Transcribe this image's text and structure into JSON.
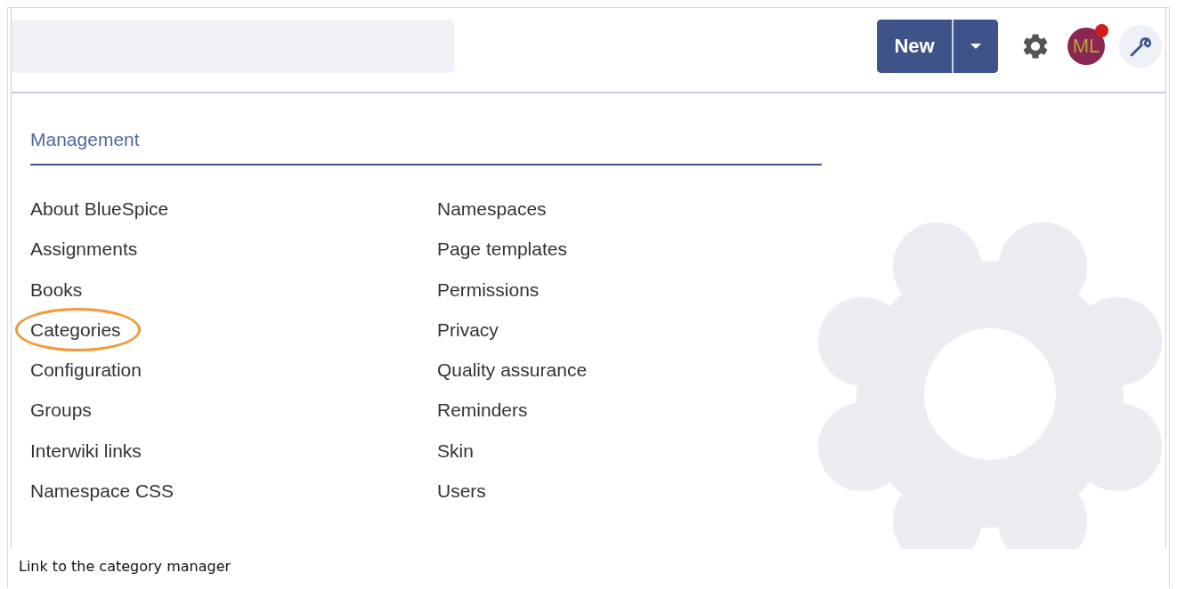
{
  "toolbar": {
    "new_button": "New"
  },
  "avatar": {
    "initials": "ML",
    "notification": true
  },
  "menu": {
    "heading": "Management",
    "columns": [
      [
        {
          "label": "About BlueSpice",
          "highlighted": false
        },
        {
          "label": "Assignments",
          "highlighted": false
        },
        {
          "label": "Books",
          "highlighted": false
        },
        {
          "label": "Categories",
          "highlighted": true
        },
        {
          "label": "Configuration",
          "highlighted": false
        },
        {
          "label": "Groups",
          "highlighted": false
        },
        {
          "label": "Interwiki links",
          "highlighted": false
        },
        {
          "label": "Namespace CSS",
          "highlighted": false
        }
      ],
      [
        {
          "label": "Namespaces",
          "highlighted": false
        },
        {
          "label": "Page templates",
          "highlighted": false
        },
        {
          "label": "Permissions",
          "highlighted": false
        },
        {
          "label": "Privacy",
          "highlighted": false
        },
        {
          "label": "Quality assurance",
          "highlighted": false
        },
        {
          "label": "Reminders",
          "highlighted": false
        },
        {
          "label": "Skin",
          "highlighted": false
        },
        {
          "label": "Users",
          "highlighted": false
        }
      ]
    ]
  },
  "caption": "Link to the category manager"
}
